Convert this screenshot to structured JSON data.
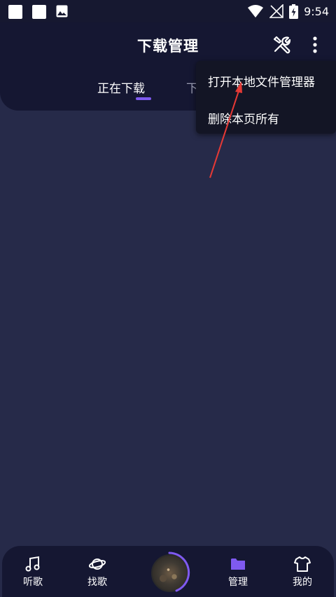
{
  "status_bar": {
    "time": "9:54"
  },
  "header": {
    "title": "下载管理",
    "tabs": [
      {
        "label": "正在下载",
        "active": true
      },
      {
        "label": "下载完成",
        "active": false
      }
    ]
  },
  "dropdown": {
    "items": [
      {
        "label": "打开本地文件管理器"
      },
      {
        "label": "删除本页所有"
      }
    ]
  },
  "bottom_nav": {
    "items": [
      {
        "label": "听歌",
        "icon": "music-note-icon"
      },
      {
        "label": "找歌",
        "icon": "planet-icon"
      },
      {
        "label": "",
        "icon": "album-disc"
      },
      {
        "label": "管理",
        "icon": "folder-icon",
        "active": true
      },
      {
        "label": "我的",
        "icon": "tshirt-icon"
      }
    ]
  },
  "colors": {
    "background": "#262a49",
    "header": "#151732",
    "accent": "#7f5af0",
    "dropdown": "#131525",
    "annotation": "#e53935"
  }
}
